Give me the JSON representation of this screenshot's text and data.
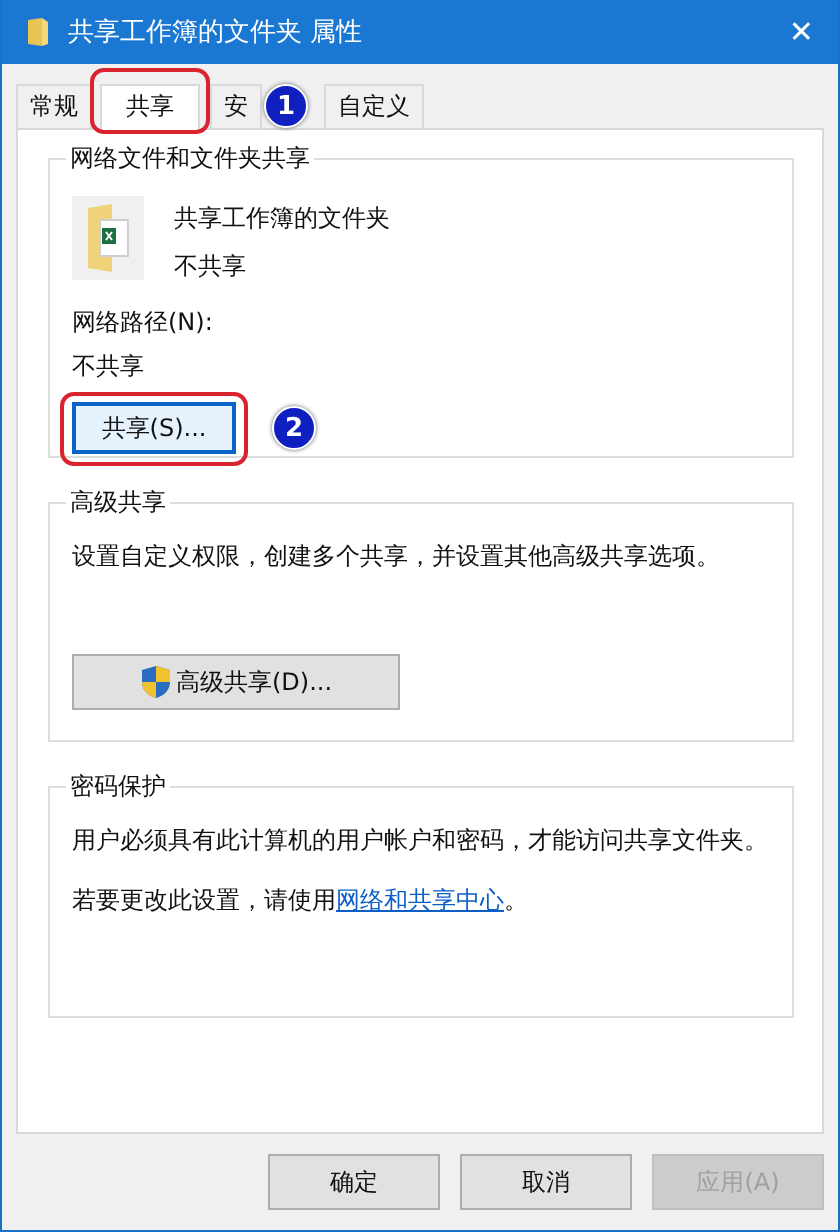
{
  "window": {
    "title": "共享工作簿的文件夹 属性",
    "close": "✕"
  },
  "tabs": [
    {
      "label": "常规",
      "selected": false
    },
    {
      "label": "共享",
      "selected": true
    },
    {
      "label": "安",
      "selected": false,
      "badge": "1"
    },
    {
      "label": "自定义",
      "selected": false
    }
  ],
  "network_sharing": {
    "title": "网络文件和文件夹共享",
    "folder_name": "共享工作簿的文件夹",
    "folder_status": "不共享",
    "path_label": "网络路径(N):",
    "path_value": "不共享",
    "share_button": "共享(S)...",
    "share_button_badge": "2"
  },
  "advanced_sharing": {
    "title": "高级共享",
    "description": "设置自定义权限，创建多个共享，并设置其他高级共享选项。",
    "button": "高级共享(D)..."
  },
  "password_protection": {
    "title": "密码保护",
    "text": "用户必须具有此计算机的用户帐户和密码，才能访问共享文件夹。",
    "change_text": "若要更改此设置，请使用",
    "link": "网络和共享中心",
    "after_link": "。"
  },
  "buttons": [
    {
      "label": "确定",
      "disabled": false
    },
    {
      "label": "取消",
      "disabled": false
    },
    {
      "label": "应用(A)",
      "disabled": true
    }
  ]
}
